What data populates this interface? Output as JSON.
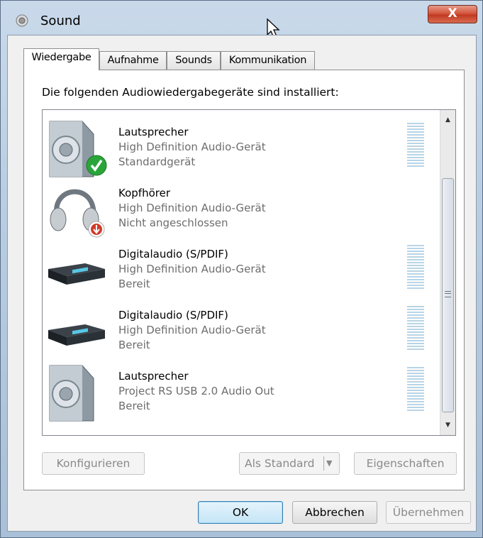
{
  "window": {
    "title": "Sound",
    "close_label": "X"
  },
  "tabs": [
    {
      "label": "Wiedergabe",
      "active": true
    },
    {
      "label": "Aufnahme",
      "active": false
    },
    {
      "label": "Sounds",
      "active": false
    },
    {
      "label": "Kommunikation",
      "active": false
    }
  ],
  "panel": {
    "intro": "Die folgenden Audiowiedergabegeräte sind installiert:"
  },
  "devices": [
    {
      "name": "Lautsprecher",
      "description": "High Definition Audio-Gerät",
      "status": "Standardgerät",
      "icon": "speaker-default-icon",
      "meter": true
    },
    {
      "name": "Kopfhörer",
      "description": "High Definition Audio-Gerät",
      "status": "Nicht angeschlossen",
      "icon": "headphones-disconnected-icon",
      "meter": false
    },
    {
      "name": "Digitalaudio (S/PDIF)",
      "description": "High Definition Audio-Gerät",
      "status": "Bereit",
      "icon": "digital-audio-receiver-icon",
      "meter": true
    },
    {
      "name": "Digitalaudio (S/PDIF)",
      "description": "High Definition Audio-Gerät",
      "status": "Bereit",
      "icon": "digital-audio-receiver-icon",
      "meter": true
    },
    {
      "name": "Lautsprecher",
      "description": "Project RS USB 2.0 Audio Out",
      "status": "Bereit",
      "icon": "speaker-icon",
      "meter": true
    }
  ],
  "panel_buttons": {
    "configure": "Konfigurieren",
    "set_default": "Als Standard",
    "properties": "Eigenschaften"
  },
  "dialog_buttons": {
    "ok": "OK",
    "cancel": "Abbrechen",
    "apply": "Übernehmen"
  },
  "colors": {
    "accent": "#3c7fb1",
    "close_button": "#c23a23",
    "default_check": "#2aa53a",
    "disconnected_badge": "#d23a2a"
  }
}
